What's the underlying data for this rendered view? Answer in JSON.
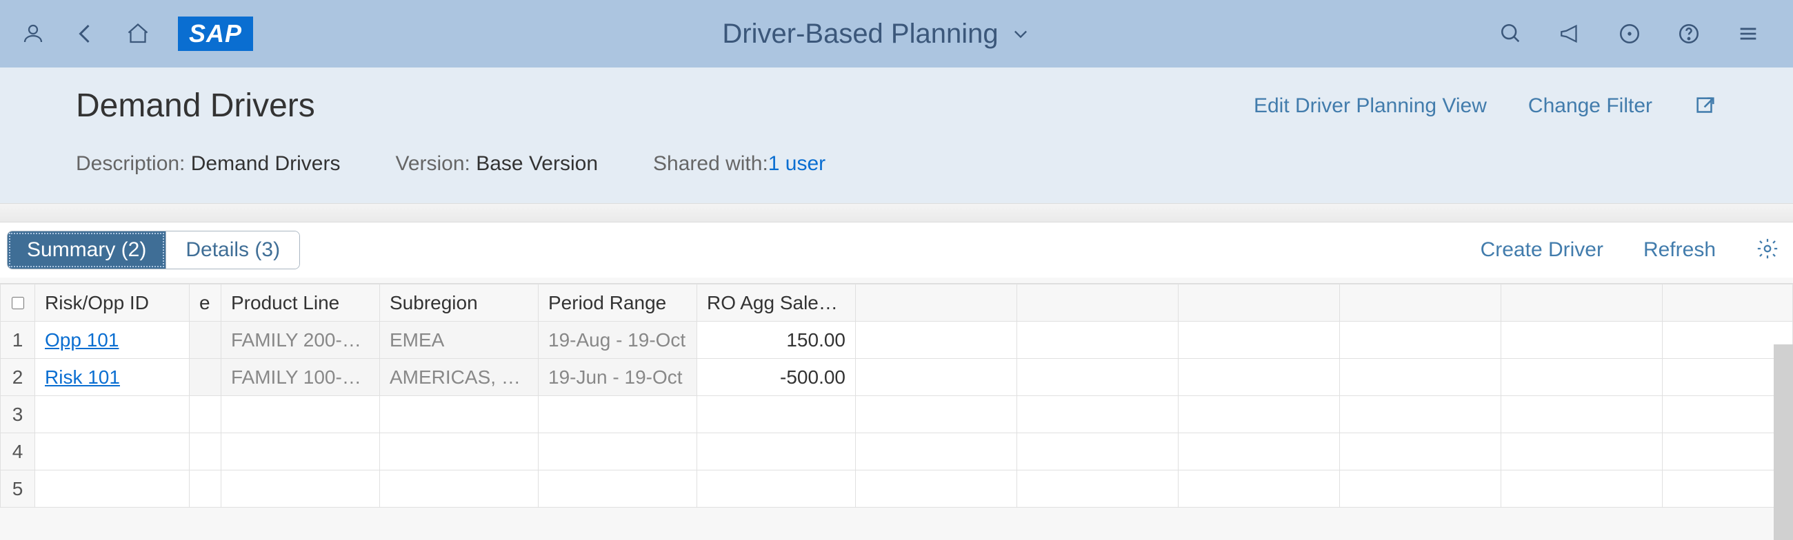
{
  "header": {
    "app_title": "Driver-Based Planning",
    "sap_logo_text": "SAP"
  },
  "icons": {
    "user": "user-icon",
    "back": "chevron-left-icon",
    "home": "home-icon",
    "dropdown": "chevron-down-icon",
    "search": "search-icon",
    "megaphone": "megaphone-icon",
    "target": "circle-target-icon",
    "help": "help-icon",
    "list": "list-icon",
    "share": "share-icon",
    "gear": "gear-icon"
  },
  "sub": {
    "page_title": "Demand Drivers",
    "edit_link": "Edit Driver Planning View",
    "change_filter": "Change Filter",
    "desc_label": "Description:",
    "desc_value": "Demand Drivers",
    "version_label": "Version:",
    "version_value": "Base Version",
    "shared_label": "Shared with:",
    "shared_value": "1 user"
  },
  "tabs": {
    "summary": "Summary (2)",
    "details": "Details (3)"
  },
  "toolbar": {
    "create": "Create Driver",
    "refresh": "Refresh"
  },
  "grid": {
    "columns": {
      "risk_opp": "Risk/Opp ID",
      "e": "e",
      "product_line": "Product Line",
      "subregion": "Subregion",
      "period_range": "Period Range",
      "ro_agg": "RO Agg Sales ..."
    },
    "rows": [
      {
        "n": "1",
        "id": "Opp 101",
        "prod": "FAMILY 200-H...",
        "sub": "EMEA",
        "period": "19-Aug - 19-Oct",
        "agg": "150.00"
      },
      {
        "n": "2",
        "id": "Risk 101",
        "prod": "FAMILY 100-H...",
        "sub": "AMERICAS, E...",
        "period": "19-Jun - 19-Oct",
        "agg": "-500.00"
      },
      {
        "n": "3",
        "id": "",
        "prod": "",
        "sub": "",
        "period": "",
        "agg": ""
      },
      {
        "n": "4",
        "id": "",
        "prod": "",
        "sub": "",
        "period": "",
        "agg": ""
      },
      {
        "n": "5",
        "id": "",
        "prod": "",
        "sub": "",
        "period": "",
        "agg": ""
      }
    ]
  }
}
